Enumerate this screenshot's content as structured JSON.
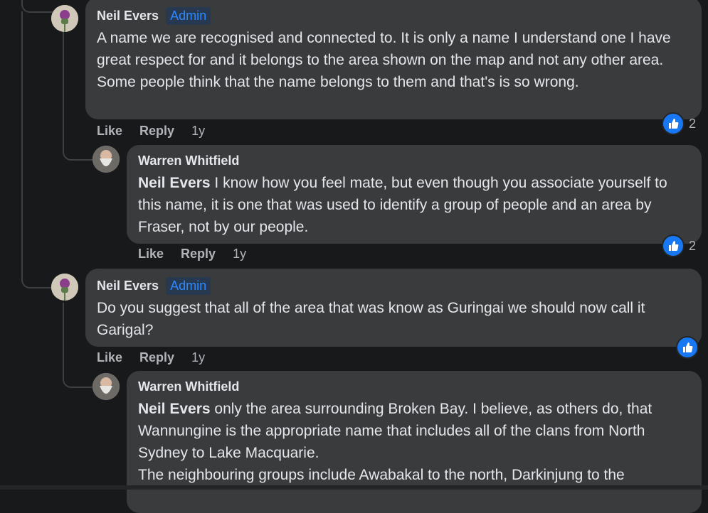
{
  "comments": [
    {
      "author": "Neil Evers",
      "badge": "Admin",
      "text": "A name we are recognised and connected to. It is only a name I understand one I have great respect for and it belongs to the area shown on the map and not any other area. Some people think that the name belongs to them and that's is so wrong.",
      "actions": {
        "like": "Like",
        "reply": "Reply",
        "time": "1y"
      },
      "reactions": "2"
    },
    {
      "author": "Warren Whitfield",
      "mention": "Neil Evers",
      "text": " I know how you feel mate, but even though you associate yourself to this name, it is one that was used to identify a group of people and an area by Fraser, not by our people.",
      "actions": {
        "like": "Like",
        "reply": "Reply",
        "time": "1y"
      },
      "reactions": "2"
    },
    {
      "author": "Neil Evers",
      "badge": "Admin",
      "text": "Do you suggest that all of the area that was know as Guringai we should now call it Garigal?",
      "actions": {
        "like": "Like",
        "reply": "Reply",
        "time": "1y"
      }
    },
    {
      "author": "Warren Whitfield",
      "mention": "Neil Evers",
      "text": " only the area surrounding Broken Bay. I believe, as others do, that Wannungine is the appropriate name that includes all of the clans from North Sydney to Lake Macquarie.",
      "text2": "The neighbouring groups include Awabakal to the north, Darkinjung to the"
    }
  ],
  "icons": {
    "like": "like-icon",
    "avatar_neil": "thistle-avatar",
    "avatar_warren": "bearded-man-avatar"
  },
  "colors": {
    "background": "#18191a",
    "bubble": "#3a3b3c",
    "accent": "#2d88ff",
    "like": "#1877f2"
  }
}
